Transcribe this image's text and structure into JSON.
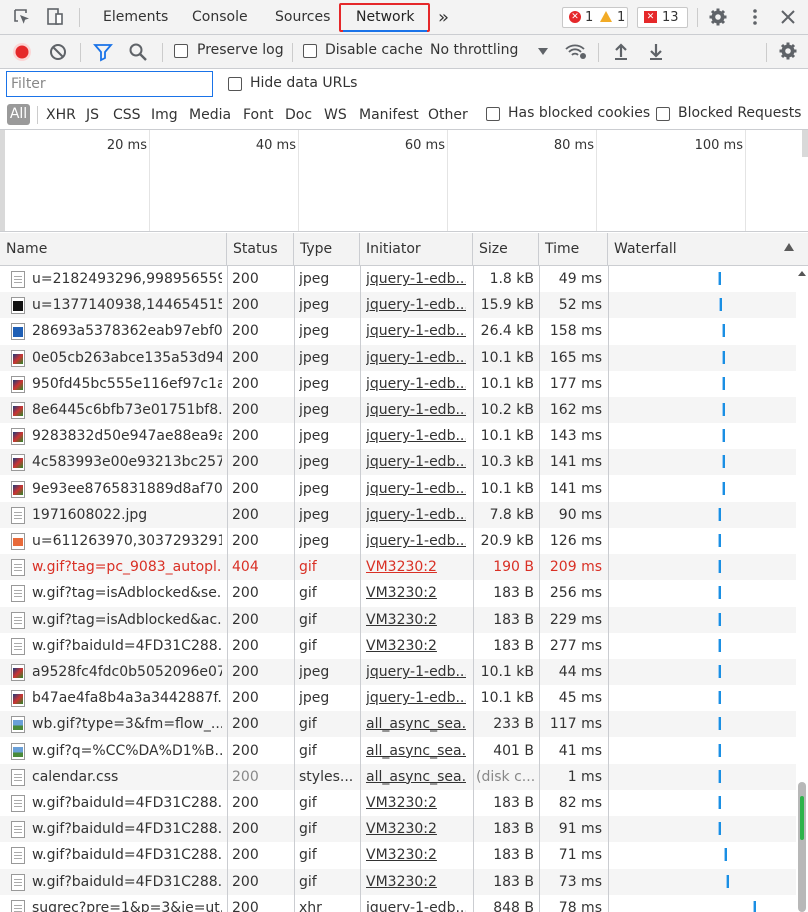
{
  "tabs": {
    "elements": "Elements",
    "console": "Console",
    "sources": "Sources",
    "network": "Network",
    "more": "»"
  },
  "badges": {
    "errors": "1",
    "warnings": "1",
    "issues": "13"
  },
  "toolbar": {
    "preserve_log": "Preserve log",
    "disable_cache": "Disable cache",
    "throttling": "No throttling"
  },
  "filter": {
    "placeholder": "Filter",
    "hide_data_urls": "Hide data URLs"
  },
  "types": {
    "all": "All",
    "items": [
      "XHR",
      "JS",
      "CSS",
      "Img",
      "Media",
      "Font",
      "Doc",
      "WS",
      "Manifest",
      "Other"
    ],
    "has_blocked_cookies": "Has blocked cookies",
    "blocked_requests": "Blocked Requests"
  },
  "overview": {
    "ticks": [
      "20 ms",
      "40 ms",
      "60 ms",
      "80 ms",
      "100 ms"
    ]
  },
  "columns": {
    "name": "Name",
    "status": "Status",
    "type": "Type",
    "initiator": "Initiator",
    "size": "Size",
    "time": "Time",
    "waterfall": "Waterfall"
  },
  "rows": [
    {
      "name": "u=2182493296,998956559...",
      "status": "200",
      "type": "jpeg",
      "initiator": "jquery-1-edb...",
      "size": "1.8 kB",
      "time": "49 ms",
      "thumb": "doc",
      "wf": 718
    },
    {
      "name": "u=1377140938,144654515...",
      "status": "200",
      "type": "jpeg",
      "initiator": "jquery-1-edb...",
      "size": "15.9 kB",
      "time": "52 ms",
      "thumb": "dark",
      "wf": 719
    },
    {
      "name": "28693a5378362eab97ebf0...",
      "status": "200",
      "type": "jpeg",
      "initiator": "jquery-1-edb...",
      "size": "26.4 kB",
      "time": "158 ms",
      "thumb": "blue",
      "wf": 722
    },
    {
      "name": "0e05cb263abce135a53d94...",
      "status": "200",
      "type": "jpeg",
      "initiator": "jquery-1-edb...",
      "size": "10.1 kB",
      "time": "165 ms",
      "thumb": "img",
      "wf": 722
    },
    {
      "name": "950fd45bc555e116ef97c1a...",
      "status": "200",
      "type": "jpeg",
      "initiator": "jquery-1-edb...",
      "size": "10.1 kB",
      "time": "177 ms",
      "thumb": "img",
      "wf": 722
    },
    {
      "name": "8e6445c6bfb73e01751bf8...",
      "status": "200",
      "type": "jpeg",
      "initiator": "jquery-1-edb...",
      "size": "10.2 kB",
      "time": "162 ms",
      "thumb": "img",
      "wf": 722
    },
    {
      "name": "9283832d50e947ae88ea9a...",
      "status": "200",
      "type": "jpeg",
      "initiator": "jquery-1-edb...",
      "size": "10.1 kB",
      "time": "143 ms",
      "thumb": "img",
      "wf": 722
    },
    {
      "name": "4c583993e00e93213bc257...",
      "status": "200",
      "type": "jpeg",
      "initiator": "jquery-1-edb...",
      "size": "10.3 kB",
      "time": "141 ms",
      "thumb": "img",
      "wf": 722
    },
    {
      "name": "9e93ee8765831889d8af70...",
      "status": "200",
      "type": "jpeg",
      "initiator": "jquery-1-edb...",
      "size": "10.1 kB",
      "time": "141 ms",
      "thumb": "img",
      "wf": 722
    },
    {
      "name": "1971608022.jpg",
      "status": "200",
      "type": "jpeg",
      "initiator": "jquery-1-edb...",
      "size": "7.8 kB",
      "time": "90 ms",
      "thumb": "doc",
      "wf": 718
    },
    {
      "name": "u=611263970,3037293291...",
      "status": "200",
      "type": "jpeg",
      "initiator": "jquery-1-edb...",
      "size": "20.9 kB",
      "time": "126 ms",
      "thumb": "orange",
      "wf": 718
    },
    {
      "name": "w.gif?tag=pc_9083_autopl...",
      "status": "404",
      "type": "gif",
      "initiator": "VM3230:2",
      "size": "190 B",
      "time": "209 ms",
      "thumb": "doc",
      "wf": 718,
      "error": true
    },
    {
      "name": "w.gif?tag=isAdblocked&se...",
      "status": "200",
      "type": "gif",
      "initiator": "VM3230:2",
      "size": "183 B",
      "time": "256 ms",
      "thumb": "doc",
      "wf": 718
    },
    {
      "name": "w.gif?tag=isAdblocked&ac...",
      "status": "200",
      "type": "gif",
      "initiator": "VM3230:2",
      "size": "183 B",
      "time": "229 ms",
      "thumb": "doc",
      "wf": 718
    },
    {
      "name": "w.gif?baiduId=4FD31C288...",
      "status": "200",
      "type": "gif",
      "initiator": "VM3230:2",
      "size": "183 B",
      "time": "277 ms",
      "thumb": "doc",
      "wf": 718
    },
    {
      "name": "a9528fc4fdc0b5052096e07...",
      "status": "200",
      "type": "jpeg",
      "initiator": "jquery-1-edb...",
      "size": "10.1 kB",
      "time": "44 ms",
      "thumb": "img",
      "wf": 718
    },
    {
      "name": "b47ae4fa8b4a3a3442887f...",
      "status": "200",
      "type": "jpeg",
      "initiator": "jquery-1-edb...",
      "size": "10.1 kB",
      "time": "45 ms",
      "thumb": "img",
      "wf": 718
    },
    {
      "name": "wb.gif?type=3&fm=flow_...",
      "status": "200",
      "type": "gif",
      "initiator": "all_async_sea...",
      "size": "233 B",
      "time": "117 ms",
      "thumb": "pic",
      "wf": 718
    },
    {
      "name": "w.gif?q=%CC%DA%D1%B...",
      "status": "200",
      "type": "gif",
      "initiator": "all_async_sea...",
      "size": "401 B",
      "time": "41 ms",
      "thumb": "pic",
      "wf": 718
    },
    {
      "name": "calendar.css",
      "status": "200",
      "type": "styles...",
      "initiator": "all_async_sea...",
      "size": "(disk c...",
      "time": "1 ms",
      "thumb": "doc",
      "wf": 718,
      "cached": true
    },
    {
      "name": "w.gif?baiduId=4FD31C288...",
      "status": "200",
      "type": "gif",
      "initiator": "VM3230:2",
      "size": "183 B",
      "time": "82 ms",
      "thumb": "doc",
      "wf": 718
    },
    {
      "name": "w.gif?baiduId=4FD31C288...",
      "status": "200",
      "type": "gif",
      "initiator": "VM3230:2",
      "size": "183 B",
      "time": "91 ms",
      "thumb": "doc",
      "wf": 718
    },
    {
      "name": "w.gif?baiduId=4FD31C288...",
      "status": "200",
      "type": "gif",
      "initiator": "VM3230:2",
      "size": "183 B",
      "time": "71 ms",
      "thumb": "doc",
      "wf": 724
    },
    {
      "name": "w.gif?baiduId=4FD31C288...",
      "status": "200",
      "type": "gif",
      "initiator": "VM3230:2",
      "size": "183 B",
      "time": "73 ms",
      "thumb": "doc",
      "wf": 726
    },
    {
      "name": "sugrec?pre=1&p=3&ie=ut...",
      "status": "200",
      "type": "xhr",
      "initiator": "jquery-1-edb...",
      "size": "848 B",
      "time": "78 ms",
      "thumb": "doc",
      "wf": 753
    }
  ]
}
